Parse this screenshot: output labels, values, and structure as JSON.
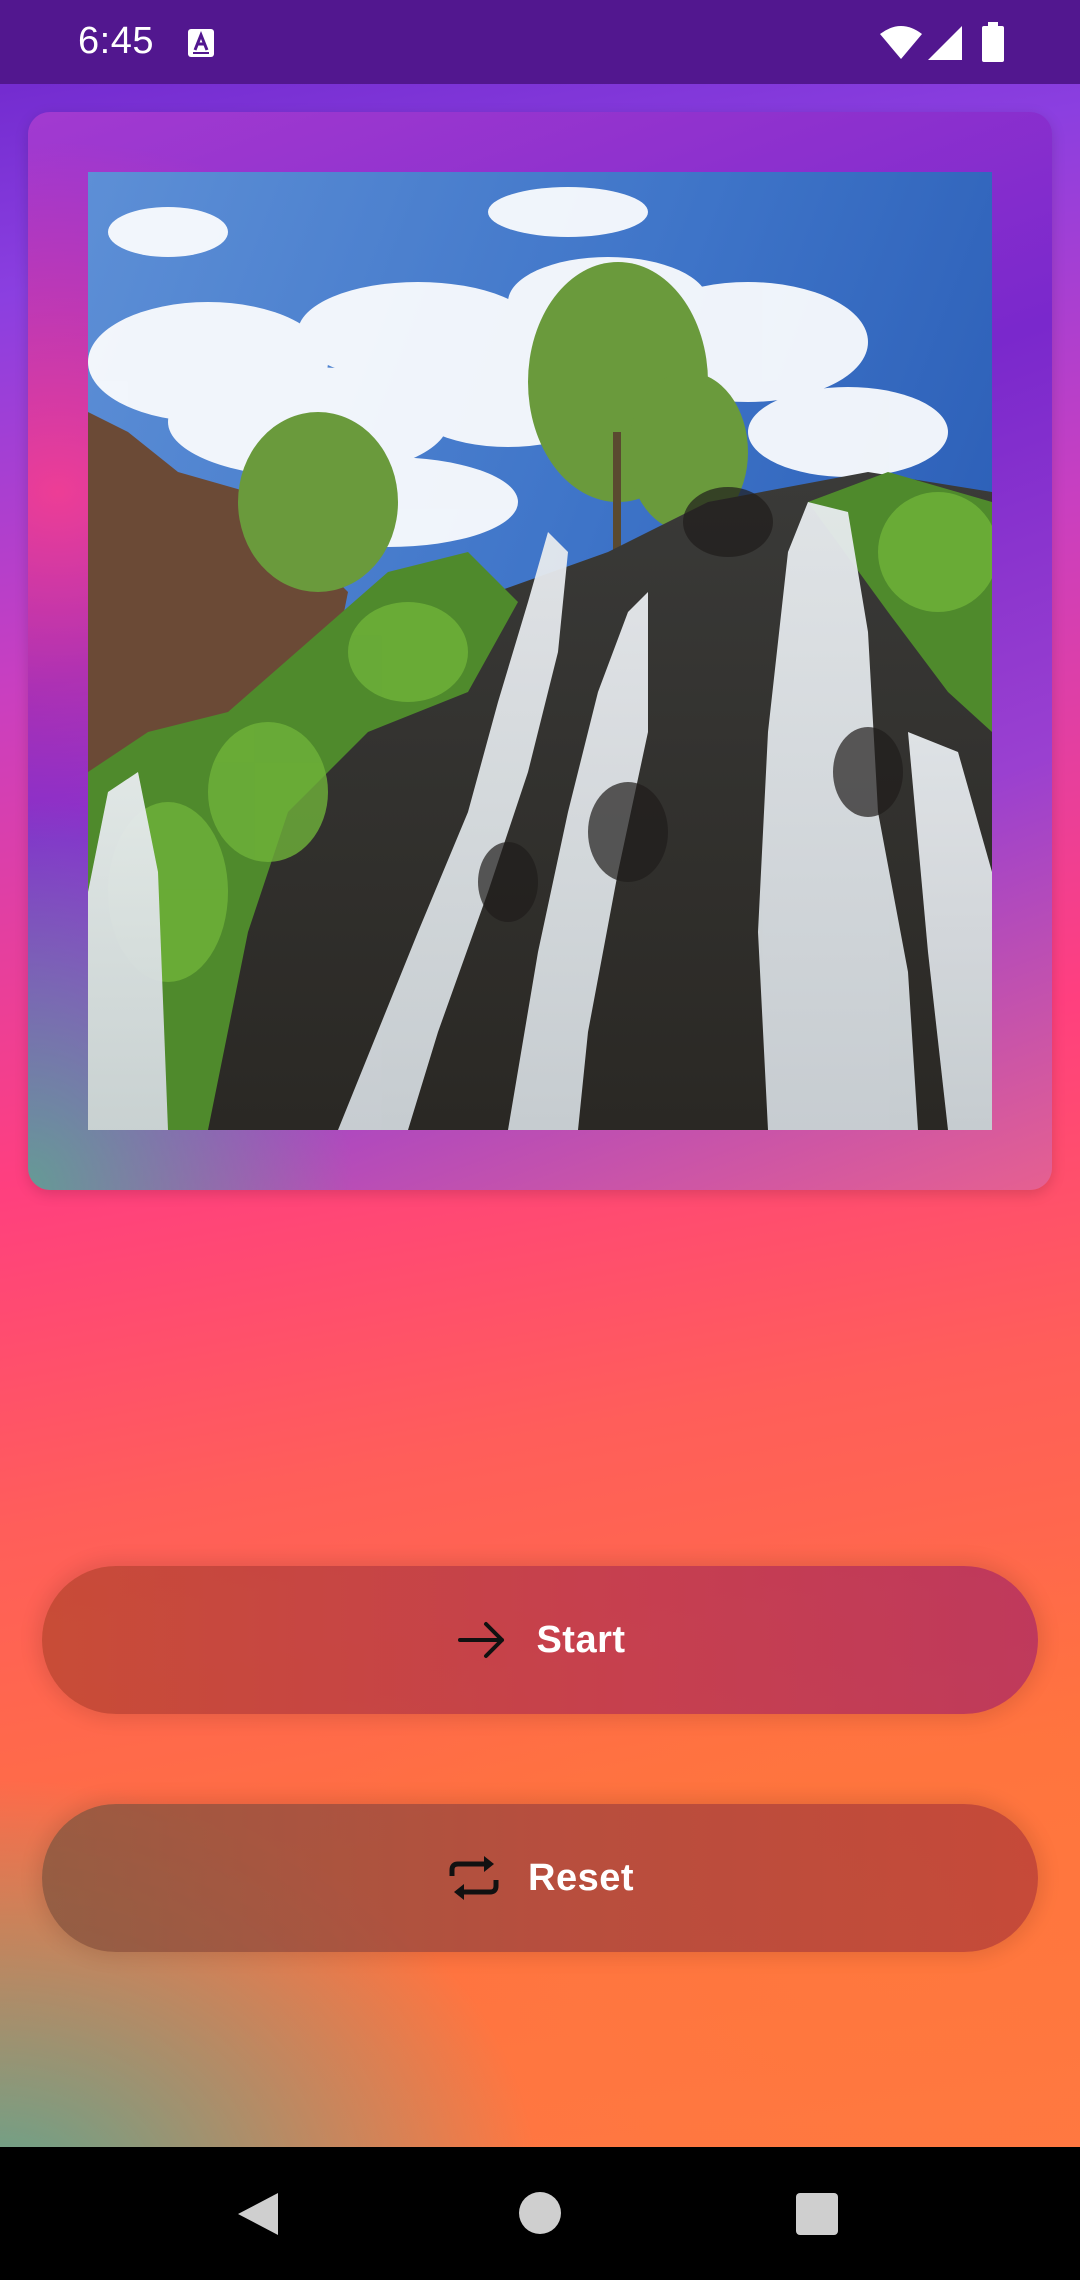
{
  "status_bar": {
    "time": "6:45",
    "icons": [
      "keyboard-a-icon",
      "wifi-icon",
      "signal-icon",
      "battery-icon"
    ]
  },
  "image_card": {
    "photo": "waterfall-photo"
  },
  "buttons": {
    "start": {
      "label": "Start",
      "icon": "arrow-right-icon"
    },
    "reset": {
      "label": "Reset",
      "icon": "repeat-icon"
    }
  },
  "nav_bar": {
    "icons": [
      "back-icon",
      "home-icon",
      "recents-icon"
    ]
  },
  "colors": {
    "status_bar": "#52178f",
    "gradient_top": "#6a24c9",
    "gradient_mid": "#ff3f7f",
    "gradient_bottom": "#ff7a45",
    "button_text": "#ffffff"
  }
}
